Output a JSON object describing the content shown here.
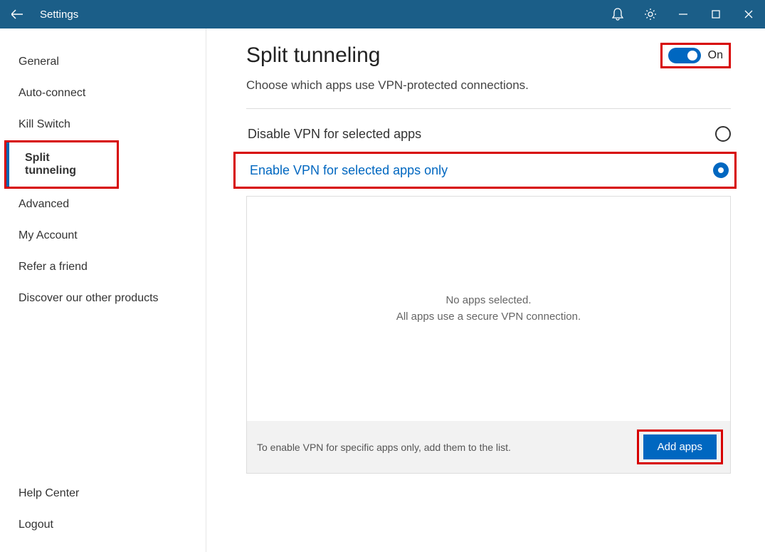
{
  "titlebar": {
    "title": "Settings"
  },
  "sidebar": {
    "items": [
      {
        "label": "General"
      },
      {
        "label": "Auto-connect"
      },
      {
        "label": "Kill Switch"
      },
      {
        "label": "Split tunneling"
      },
      {
        "label": "Advanced"
      },
      {
        "label": "My Account"
      },
      {
        "label": "Refer a friend"
      },
      {
        "label": "Discover our other products"
      }
    ],
    "bottom": [
      {
        "label": "Help Center"
      },
      {
        "label": "Logout"
      }
    ]
  },
  "main": {
    "title": "Split tunneling",
    "subtitle": "Choose which apps use VPN-protected connections.",
    "toggle": {
      "state": "On"
    },
    "options": [
      {
        "label": "Disable VPN for selected apps",
        "selected": false
      },
      {
        "label": "Enable VPN for selected apps only",
        "selected": true
      }
    ],
    "apps": {
      "empty_line1": "No apps selected.",
      "empty_line2": "All apps use a secure VPN connection.",
      "footer_hint": "To enable VPN for specific apps only, add them to the list.",
      "add_button": "Add apps"
    }
  },
  "annotations": {
    "highlight_color": "#d70000",
    "accent_color": "#0067c0",
    "titlebar_color": "#1b5e88"
  }
}
